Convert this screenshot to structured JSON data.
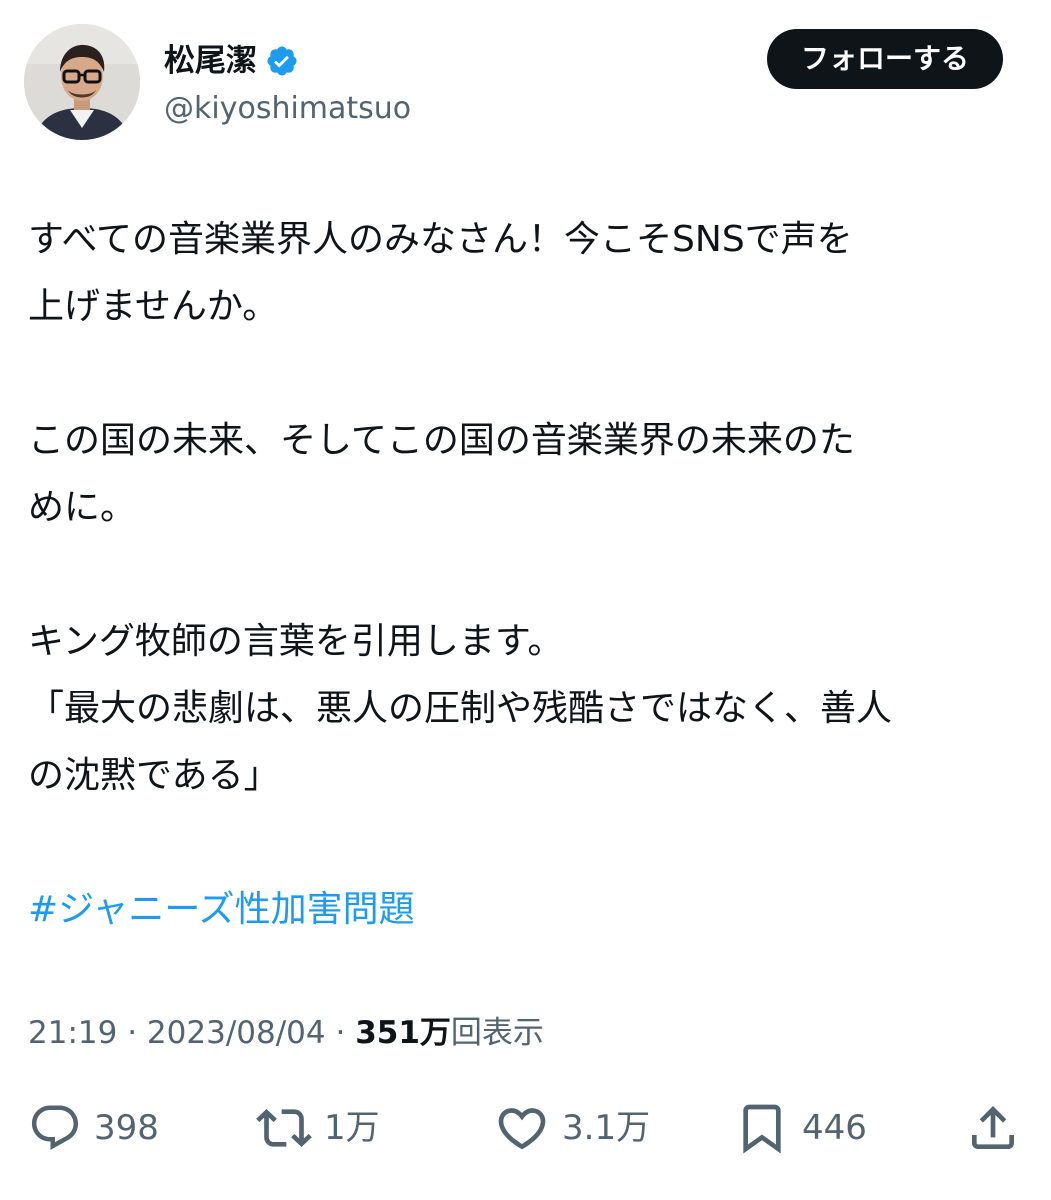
{
  "user": {
    "display_name": "松尾潔",
    "handle": "@kiyoshimatsuo",
    "verified": true,
    "verified_color": "#1d9bf0",
    "avatar_icon": "avatar-photo"
  },
  "follow_button": {
    "label": "フォローする"
  },
  "tweet": {
    "line1": "すべての音楽業界人のみなさん！今こそSNSで声を",
    "line2": "上げませんか。",
    "line3": "この国の未来、そしてこの国の音楽業界の未来のた",
    "line4": "めに。",
    "line5": "キング牧師の言葉を引用します。",
    "line6": "「最大の悲劇は、悪人の圧制や残酷さではなく、善人",
    "line7": "の沈黙である」",
    "hashtag": "#ジャニーズ性加害問題",
    "hashtag_color": "#1d9bf0"
  },
  "meta": {
    "time": "21:19",
    "separator": "·",
    "date": "2023/08/04",
    "views_count": "351万",
    "views_label": "回表示"
  },
  "actions": {
    "replies": {
      "icon": "reply-icon",
      "count": "398"
    },
    "retweets": {
      "icon": "retweet-icon",
      "count": "1万"
    },
    "likes": {
      "icon": "heart-icon",
      "count": "3.1万"
    },
    "bookmarks": {
      "icon": "bookmark-icon",
      "count": "446"
    },
    "share": {
      "icon": "share-icon"
    }
  }
}
